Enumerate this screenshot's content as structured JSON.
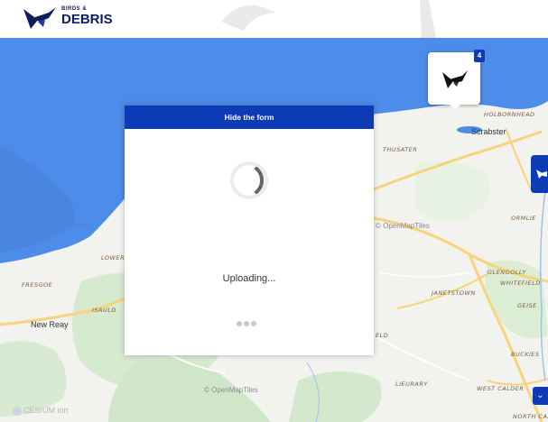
{
  "header": {
    "brand_small": "BIRDS &",
    "brand_big": "DEBRIS"
  },
  "map": {
    "labels": {
      "holborn_head": "HOLBORNHEAD",
      "scrabster": "Scrabster",
      "thusater": "THUSATER",
      "ormlie": "ORMLIE",
      "glengolly": "GLENGOLLY",
      "whitefield": "WHITEFIELD",
      "janetstown": "JANETSTOWN",
      "geise": "GEISE",
      "lower": "LOWER L",
      "fresgoe": "FRESGOE",
      "isauld": "ISAULD",
      "new_reay": "New Reay",
      "buckies": "BUCKIES",
      "lieurary": "LIEURARY",
      "west_calder": "WEST CALDER",
      "north_calder": "NORTH CAL",
      "eld": "ELD",
      "watermark_right": "© OpenMapTiles",
      "watermark_sea": "© OpenMapTiles",
      "watermark_bottom": "© OpenMapTiles"
    },
    "marker_count": "4",
    "cesium_text": "CESIUM ion"
  },
  "modal": {
    "header_label": "Hide the form",
    "status_text": "Uploading..."
  },
  "colors": {
    "primary_blue": "#0d3bb5",
    "sea": "#4d8ce8",
    "land": "#f2f2ef",
    "road": "#f7d37a"
  },
  "icons": {
    "logo": "bird-logo-icon",
    "marker": "bird-marker-icon",
    "spinner": "loading-spinner-icon",
    "chevron": "chevron-down-icon"
  }
}
